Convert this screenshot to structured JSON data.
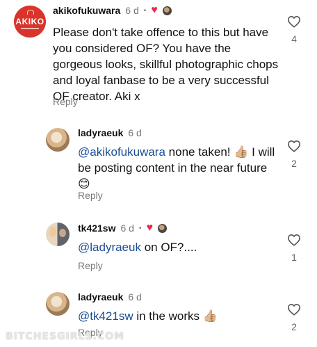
{
  "comments": [
    {
      "avatar_text": "AKIKO",
      "username": "akikofukuwara",
      "time": "6 d",
      "separator": "•",
      "body": "Please don't take offence to this but have you considered OF? You have the gorgeous looks, skillful photographic chops and loyal fanbase to be a very successful OF creator. Aki x",
      "reply_label": "Reply",
      "like_count": "4",
      "liked_by_author": true
    },
    {
      "username": "ladyraeuk",
      "time": "6 d",
      "mention": "@akikofukuwara",
      "body_line1": " none taken! 👍🏼 I will",
      "body_line2": "be posting content in the near future",
      "body_line3": "😊",
      "reply_label": "Reply",
      "like_count": "2"
    },
    {
      "username": "tk421sw",
      "time": "6 d",
      "separator": "•",
      "mention": "@ladyraeuk",
      "body": " on OF?....",
      "reply_label": "Reply",
      "like_count": "1",
      "liked_by_author": true
    },
    {
      "username": "ladyraeuk",
      "time": "6 d",
      "mention": "@tk421sw",
      "body": " in the works 👍🏼",
      "reply_label": "Reply",
      "like_count": "2"
    }
  ],
  "watermark": "BITCHESGIRLS.COM",
  "colors": {
    "mention": "#1a4c95",
    "heart": "#ed2846",
    "muted": "#777777",
    "brand": "#d9342b"
  },
  "icons": {
    "like": "heart-outline-icon",
    "author_like": "heart-filled-icon"
  }
}
